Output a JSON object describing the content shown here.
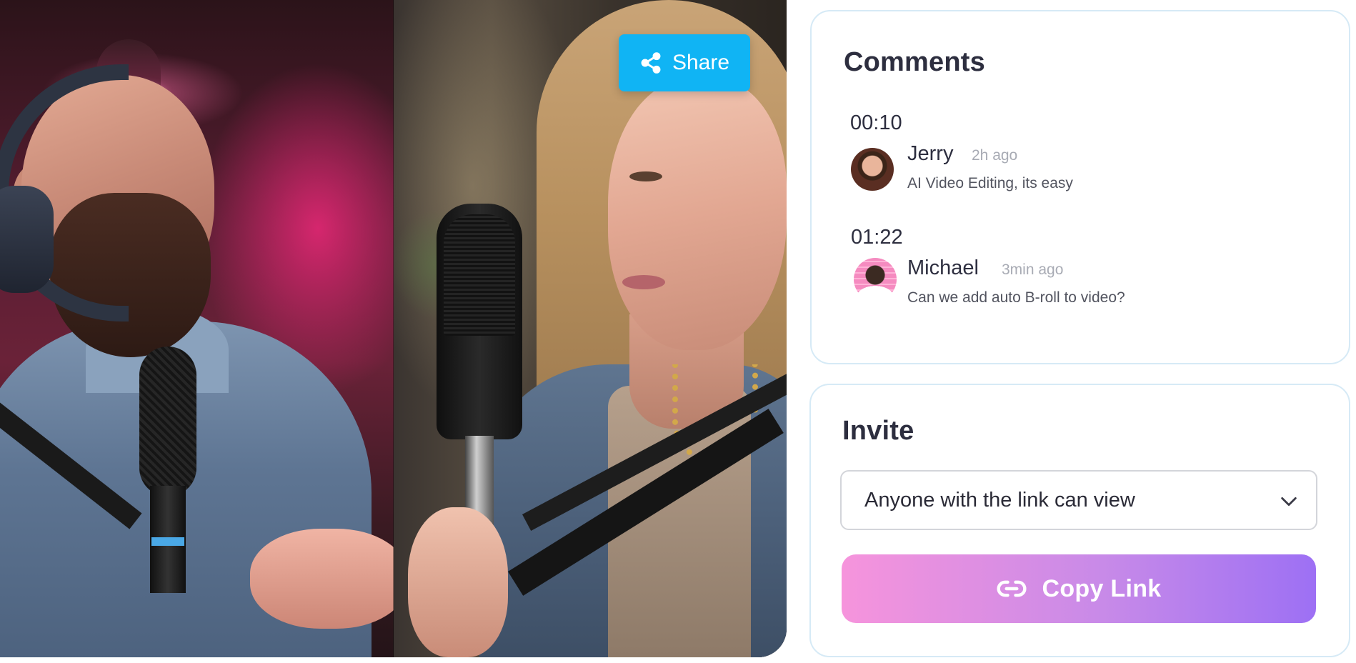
{
  "share": {
    "label": "Share",
    "icon": "share-icon"
  },
  "comments": {
    "title": "Comments",
    "items": [
      {
        "timestamp": "00:10",
        "author": "Jerry",
        "time_ago": "2h ago",
        "text": "AI Video Editing, its easy"
      },
      {
        "timestamp": "01:22",
        "author": "Michael",
        "time_ago": "3min ago",
        "text": "Can we add auto B-roll to video?"
      }
    ]
  },
  "invite": {
    "title": "Invite",
    "permission": "Anyone with the link can view",
    "copy_label": "Copy Link",
    "copy_icon": "link-icon"
  },
  "colors": {
    "share_button": "#10b4f4",
    "copy_gradient_start": "#f694dc",
    "copy_gradient_end": "#9d70f4",
    "card_border": "#d6eaf6"
  }
}
